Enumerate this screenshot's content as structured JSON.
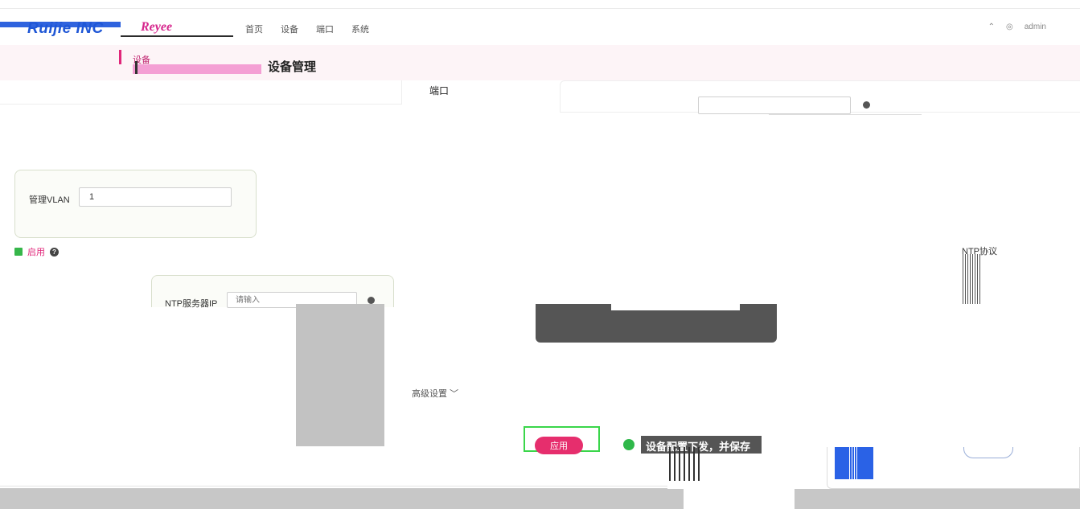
{
  "header": {
    "logo": "Ruijie INC",
    "brand": "Reyee",
    "nav": [
      "首页",
      "设备",
      "端口",
      "系统"
    ],
    "user": "admin"
  },
  "sidebar": {
    "active_item": "设备"
  },
  "page": {
    "title": "设备管理",
    "port_tab": "端口"
  },
  "form": {
    "vlan_label": "管理VLAN",
    "vlan_value": "1",
    "enable_label": "启用",
    "ntp_protocol_label": "NTP协议",
    "ntp_server_label": "NTP服务器IP",
    "ntp_server_placeholder": "请输入",
    "advanced_label": "高级设置",
    "advanced_chevron": "chevron-down-icon"
  },
  "actions": {
    "apply_label": "应用"
  },
  "toast": {
    "message": "设备配置下发，并保存",
    "icon": "check-circle-icon"
  },
  "colors": {
    "accent": "#e0267a",
    "apply": "#e62e6d",
    "success": "#2fb84a",
    "brand_blue": "#1f57d6"
  }
}
